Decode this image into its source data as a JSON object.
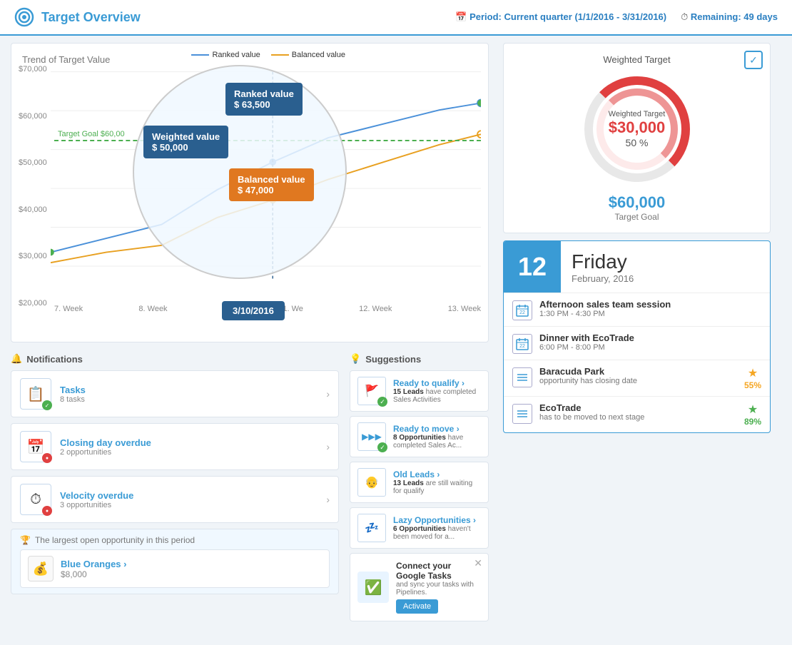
{
  "header": {
    "title": "Target Overview",
    "period_label": "Period:",
    "period_value": "Current quarter (1/1/2016 - 3/31/2016)",
    "remaining_label": "Remaining:",
    "remaining_value": "49 days"
  },
  "chart": {
    "title": "Trend of Target Value",
    "legend": {
      "ranked": "Ranked value",
      "balanced": "Balanced value"
    },
    "tooltip_ranked_label": "Ranked value",
    "tooltip_ranked_value": "$ 63,500",
    "tooltip_weighted_label": "Weighted value",
    "tooltip_weighted_value": "$ 50,000",
    "tooltip_balanced_label": "Balanced value",
    "tooltip_balanced_value": "$ 47,000",
    "date_badge": "3/10/2016",
    "y_labels": [
      "$70,000",
      "$60,000",
      "$50,000",
      "$40,000",
      "$30,000",
      "$20,000"
    ],
    "x_labels": [
      "7. Week",
      "8. Week",
      "",
      "11. We",
      "12. Week",
      "13. Week"
    ],
    "target_goal_label": "Target Goal $60,00"
  },
  "gauge": {
    "title": "Weighted Target",
    "value": "$30,000",
    "percent": "50 %",
    "target_goal_value": "$60,000",
    "target_goal_label": "Target Goal"
  },
  "calendar": {
    "day_num": "12",
    "day_name": "Friday",
    "month": "February, 2016",
    "events": [
      {
        "icon": "22",
        "title": "Afternoon sales team session",
        "time": "1:30 PM - 4:30 PM",
        "has_star": false
      },
      {
        "icon": "22",
        "title": "Dinner with EcoTrade",
        "time": "6:00 PM - 8:00 PM",
        "has_star": false
      },
      {
        "icon": "≡",
        "title": "Baracuda Park",
        "subtitle": "opportunity has closing date",
        "star_type": "gold",
        "star_pct": "55%"
      },
      {
        "icon": "≡",
        "title": "EcoTrade",
        "subtitle": "has to be moved to next stage",
        "star_type": "green",
        "star_pct": "89%"
      }
    ]
  },
  "notifications": {
    "header": "Notifications",
    "items": [
      {
        "id": "tasks",
        "icon": "📋",
        "badge": "green",
        "title": "Tasks",
        "sub": "8 tasks"
      },
      {
        "id": "closing-day",
        "icon": "📅",
        "badge": "red",
        "title": "Closing day overdue",
        "sub": "2 opportunities"
      },
      {
        "id": "velocity",
        "icon": "⏱",
        "badge": "red",
        "title": "Velocity overdue",
        "sub": "3 opportunities"
      }
    ]
  },
  "largest_opportunity": {
    "header": "The largest open opportunity in this period",
    "name": "Blue Oranges ›",
    "value": "$8,000"
  },
  "suggestions": {
    "header": "Suggestions",
    "items": [
      {
        "id": "ready-to-qualify",
        "icon": "🚩",
        "check": true,
        "title": "Ready to qualify ›",
        "sub_bold": "15 Leads",
        "sub_rest": " have completed Sales Activities"
      },
      {
        "id": "ready-to-move",
        "icon": "▶▶▶",
        "check": true,
        "title": "Ready to move ›",
        "sub_bold": "8 Opportunities",
        "sub_rest": " have completed Sales Ac..."
      },
      {
        "id": "old-leads",
        "icon": "👴",
        "check": false,
        "title": "Old Leads ›",
        "sub_bold": "13 Leads",
        "sub_rest": " are still waiting for qualify"
      },
      {
        "id": "lazy-opportunities",
        "icon": "💤",
        "check": false,
        "title": "Lazy Opportunities ›",
        "sub_bold": "6 Opportunities",
        "sub_rest": " haven't been moved for a..."
      }
    ]
  },
  "promo": {
    "title": "Connect your Google Tasks",
    "sub": "and sync your tasks with Pipelines.",
    "button": "Activate"
  }
}
